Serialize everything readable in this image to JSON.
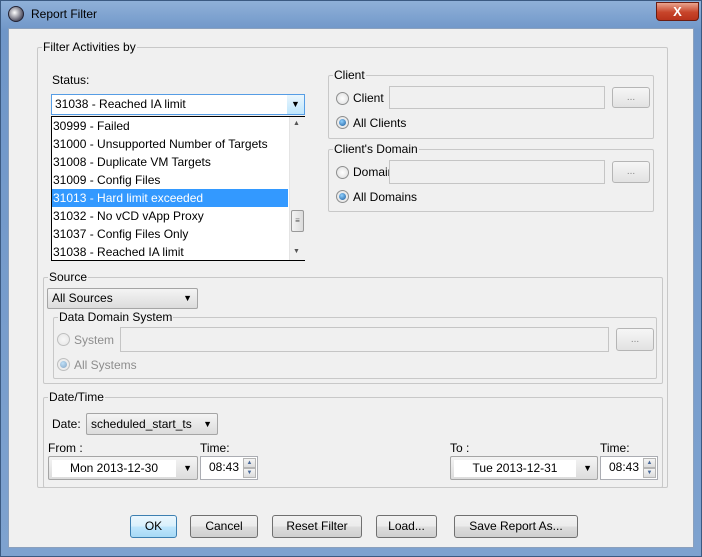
{
  "window": {
    "title": "Report Filter",
    "close": "X"
  },
  "filter": {
    "group_label": "Filter Activities by",
    "status": {
      "label": "Status:",
      "selected": "31038 - Reached IA limit",
      "options": [
        "30999 - Failed",
        "31000 - Unsupported Number of Targets",
        "31008 - Duplicate VM Targets",
        "31009 - Config Files",
        "31013 - Hard limit exceeded",
        "31032 - No vCD vApp Proxy",
        "31037 - Config Files Only",
        "31038 - Reached IA limit"
      ],
      "highlighted": "31013 - Hard limit exceeded"
    },
    "client": {
      "group_label": "Client",
      "client_label": "Client",
      "all_label": "All Clients",
      "browse": "...",
      "value": ""
    },
    "domain": {
      "group_label": "Client's Domain",
      "domain_label": "Domain",
      "all_label": "All Domains",
      "browse": "...",
      "value": ""
    },
    "source": {
      "group_label": "Source",
      "selected": "All Sources",
      "dds": {
        "group_label": "Data Domain System",
        "system_label": "System",
        "all_label": "All Systems",
        "browse": "..."
      }
    },
    "datetime": {
      "group_label": "Date/Time",
      "date_label": "Date:",
      "date_field": "scheduled_start_ts",
      "from_label": "From :",
      "from_value": "Mon 2013-12-30",
      "from_time_label": "Time:",
      "from_time": "08:43",
      "to_label": "To :",
      "to_value": "Tue 2013-12-31",
      "to_time_label": "Time:",
      "to_time": "08:43"
    }
  },
  "buttons": {
    "ok": "OK",
    "cancel": "Cancel",
    "reset": "Reset Filter",
    "load": "Load...",
    "save": "Save Report As..."
  }
}
